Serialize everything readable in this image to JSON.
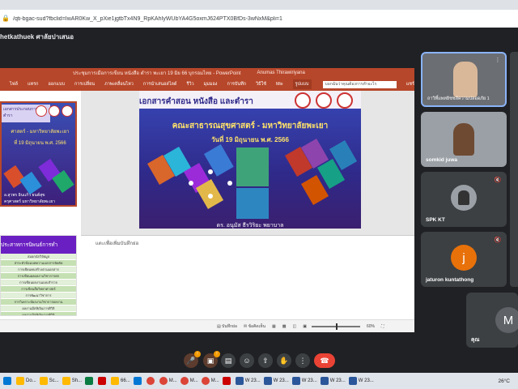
{
  "browser": {
    "url": "/qti-bgac-sud?fbclid=IwAR0Kw_X_pXie1jgtbTx4N9_RpKAhIyWUbYA4G5oxmJ624PTX0BfDs-3wNxM&pli=1"
  },
  "meet": {
    "presenter_name": "hetkathuek ศาลัยปาเสนอ"
  },
  "ppt": {
    "window_title": "ประชุมการเมือการเขียน หนังสือ ตำรา พะเยา 19 มิย 66 บุกรอมไทย  -  PowerPoint",
    "user": "Anumas Thirawiriyana",
    "search_placeholder": "บอกฉันว่าคุณต้องการทำอะไร",
    "share_label": "แชร์",
    "ribbon_tabs": [
      "ไฟล์",
      "แทรก",
      "ออกแบบ",
      "การเปลี่ยน",
      "ภาพเคลื่อนไหว",
      "การนำเสนอสไลด์",
      "รีวิว",
      "มุมมอง",
      "การบันทึก",
      "วิธีใช้",
      "Mix",
      "รูปแบบ"
    ],
    "active_tab_index": 11,
    "thumb1": {
      "title": "เอกสารประกอบการสอน ตำรา",
      "faculty": "ศาสตร์ - มหาวิทยาลัยพะเยา",
      "date": "ที่ 19 มิถุนายน พ.ศ. 2566",
      "footer": "อ.สุวพร อินแก้ว ยนต์สุข",
      "footer2": "ครุศาสตร์ มหาวิทยาลัยพะเยา"
    },
    "thumb2": {
      "header": "ประสาทการนิพนธ์การทำ",
      "rows": [
        "สมอกนักวิจัยมูล",
        "สาระหัวข้อมบทความเอกสารจัดคัด",
        "การเขียนทบสร้างตามเอกสาร",
        "การเขียนผลผลงานวิชาการตก",
        "การเขียนผลงานแบบสำรวจ",
        "การเขียนสื่อวิทยาศาสตร์",
        "การพัฒนาวิชาการ",
        "การวิเคราะห์ผลงานวิชาการผลงาน",
        "ผลงานมีสหิเจินการศิวิลิ",
        "ผลงานมีสหิเจินการศิวิลิ",
        "ผลงานมีสหิเจินการศิวิลิ",
        "ตัวอย่างงานศิ้นรูปมุ่งสิ่งการศึกษาค้วที่อยู่"
      ]
    },
    "slide": {
      "heading": "เอกสารคำสอน หนังสือ และตำรา",
      "faculty": "คณะสาธารณสุขศาสตร์ - มหาวิทยาลัยพะเยา",
      "date": "วันที่ 19 มิถุนายน พ.ศ. 2566",
      "bottom": "ดร. อนุมัส ธีรวิริยะ พยาบาล"
    },
    "notes_placeholder": "แตะเพื่อเพิ่มบันทึกย่อ",
    "status": {
      "notes": "บันทึกย่อ",
      "comments": "ข้อคิดเห็น",
      "zoom": "60%"
    }
  },
  "participants": [
    {
      "name": "",
      "caption": "ถาวิทิ์แพทยิชชล์ความปลอดภัย 1",
      "type": "video"
    },
    {
      "name": "somkid juwa",
      "type": "video"
    },
    {
      "name": "SPK KT",
      "type": "avatar-photo",
      "avatar_color": "#9aa0a6"
    },
    {
      "name": "jaturon kuntathong",
      "type": "avatar-letter",
      "letter": "j",
      "avatar_color": "#e8710a"
    },
    {
      "name": "คุณ",
      "type": "avatar-letter",
      "letter": "M",
      "avatar_color": "#5f6368"
    }
  ],
  "controls": {
    "mic_badge": "!",
    "cam_badge": "!",
    "icons": [
      "mic-icon",
      "camera-icon",
      "captions-icon",
      "emoji-icon",
      "present-icon",
      "raise-hand-icon",
      "more-icon",
      "end-call-icon"
    ]
  },
  "taskbar": {
    "items": [
      "Do...",
      "Sc...",
      "Sh...",
      "",
      "",
      "",
      "66...",
      "",
      "",
      "",
      "M...",
      "",
      "",
      "M...",
      "",
      "",
      "M...",
      "",
      "W 23...",
      "W 23...",
      "W 23...",
      "W 23...",
      "W 23..."
    ],
    "temperature": "26°C"
  }
}
